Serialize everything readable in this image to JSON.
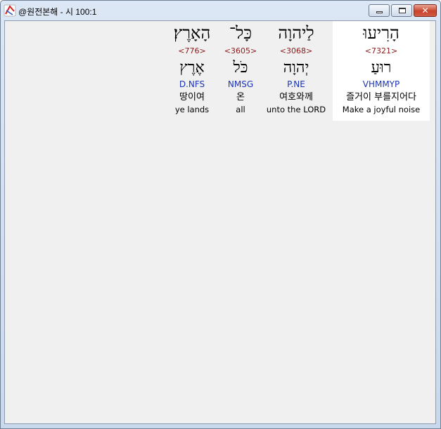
{
  "window": {
    "title": "@원전본해 - 시 100:1",
    "controls": {
      "close_glyph": "✕"
    }
  },
  "words": [
    {
      "hebrew": "הָרִיעוּ",
      "strong": "<7321>",
      "lemma": "רוּעַ",
      "morph": "VHMMYP",
      "korean": "즐거이 부를지어다",
      "english": "Make a joyful noise",
      "selected": true
    },
    {
      "hebrew": "לַיהוָה",
      "strong": "<3068>",
      "lemma": "יְהוָה",
      "morph": "P.NE",
      "korean": "여호와께",
      "english": "unto the LORD",
      "selected": false
    },
    {
      "hebrew": "כָּל־",
      "strong": "<3605>",
      "lemma": "כֹּל",
      "morph": "NMSG",
      "korean": "온",
      "english": "all",
      "selected": false
    },
    {
      "hebrew": "הָאָרֶץ׃",
      "strong": "<776>",
      "lemma": "אֶרֶץ",
      "morph": "D.NFS",
      "korean": "땅이여",
      "english": "ye lands",
      "selected": false
    }
  ]
}
